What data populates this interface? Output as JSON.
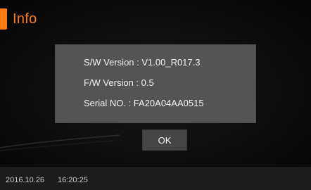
{
  "header": {
    "title": "Info",
    "accent_color": "#ff7a12"
  },
  "dialog": {
    "sw_version": "S/W Version : V1.00_R017.3",
    "fw_version": "F/W Version : 0.5",
    "serial_no": "Serial NO. : FA20A04AA0515",
    "ok_label": "OK"
  },
  "status_bar": {
    "date": "2016.10.26",
    "time": "16:20:25"
  }
}
